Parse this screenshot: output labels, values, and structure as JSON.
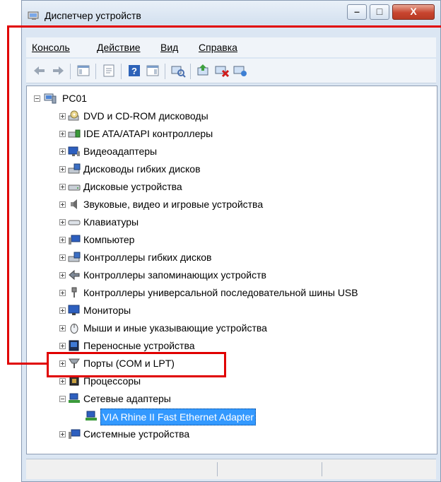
{
  "window": {
    "title": "Диспетчер устройств",
    "controls": {
      "minimize": "–",
      "maximize": "□",
      "close": "X"
    }
  },
  "menu": [
    "Консоль",
    "Действие",
    "Вид",
    "Справка"
  ],
  "toolbar": {
    "icons": [
      "back-icon",
      "forward-icon",
      "console-tree-icon",
      "properties-icon",
      "help-icon",
      "action-pane-icon",
      "scan-hardware-icon",
      "update-driver-icon",
      "disable-device-icon",
      "uninstall-device-icon"
    ]
  },
  "tree": {
    "root": "PC01",
    "items": [
      {
        "label": "DVD и CD-ROM дисководы",
        "icon": "dvd-drive-icon"
      },
      {
        "label": "IDE ATA/ATAPI контроллеры",
        "icon": "ide-controller-icon"
      },
      {
        "label": "Видеоадаптеры",
        "icon": "display-adapter-icon"
      },
      {
        "label": "Дисководы гибких дисков",
        "icon": "floppy-drive-icon"
      },
      {
        "label": "Дисковые устройства",
        "icon": "disk-drive-icon"
      },
      {
        "label": "Звуковые, видео и игровые устройства",
        "icon": "speaker-icon"
      },
      {
        "label": "Клавиатуры",
        "icon": "keyboard-icon"
      },
      {
        "label": "Компьютер",
        "icon": "computer-icon"
      },
      {
        "label": "Контроллеры гибких дисков",
        "icon": "floppy-controller-icon"
      },
      {
        "label": "Контроллеры запоминающих устройств",
        "icon": "storage-controller-icon"
      },
      {
        "label": "Контроллеры универсальной последовательной шины USB",
        "icon": "usb-icon"
      },
      {
        "label": "Мониторы",
        "icon": "monitor-icon"
      },
      {
        "label": "Мыши и иные указывающие устройства",
        "icon": "mouse-icon"
      },
      {
        "label": "Переносные устройства",
        "icon": "portable-device-icon"
      },
      {
        "label": "Порты (COM и LPT)",
        "icon": "port-icon"
      },
      {
        "label": "Процессоры",
        "icon": "processor-icon"
      },
      {
        "label": "Сетевые адаптеры",
        "icon": "network-adapter-icon",
        "expanded": true,
        "children": [
          {
            "label": "VIA Rhine II Fast Ethernet Adapter",
            "icon": "network-card-icon",
            "selected": true
          }
        ]
      },
      {
        "label": "Системные устройства",
        "icon": "system-device-icon"
      }
    ]
  },
  "colors": {
    "highlight": "#e00000",
    "selection": "#3399ff"
  }
}
